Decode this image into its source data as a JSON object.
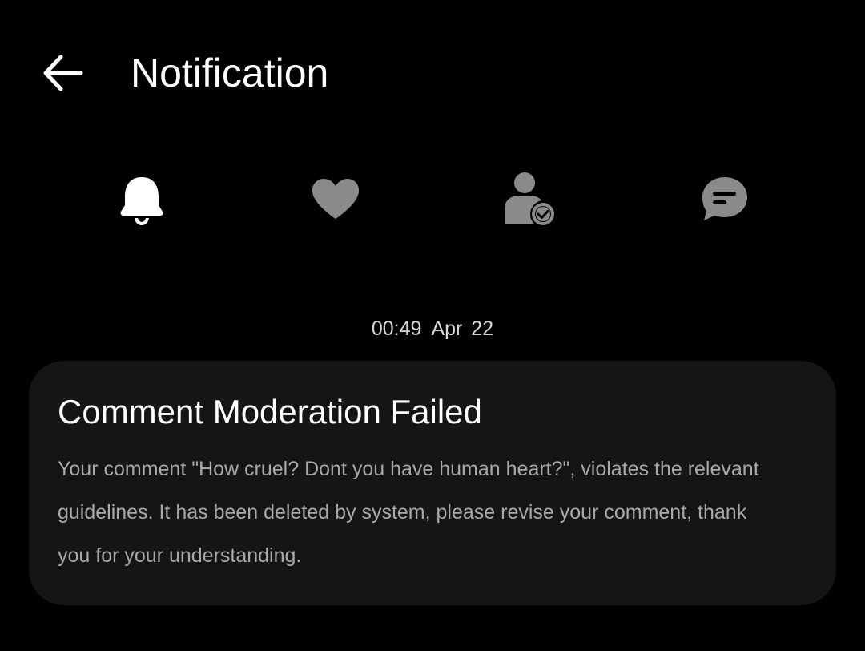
{
  "header": {
    "title": "Notification",
    "back_icon": "arrow-left-icon"
  },
  "tabs": [
    {
      "icon": "bell-icon",
      "active": true,
      "color": "#ffffff"
    },
    {
      "icon": "heart-icon",
      "active": false,
      "color": "#8a8a8a"
    },
    {
      "icon": "user-check-icon",
      "active": false,
      "color": "#8a8a8a"
    },
    {
      "icon": "chat-bubble-icon",
      "active": false,
      "color": "#8a8a8a"
    }
  ],
  "message": {
    "time": "00:49",
    "date": "Apr 22",
    "title": "Comment Moderation Failed",
    "body": "Your comment \"How cruel? Dont you have human heart?\", violates the relevant guidelines. It has been deleted by system, please revise your comment, thank you for your understanding."
  },
  "colors": {
    "background": "#000000",
    "card_background": "#151515",
    "body_text": "#a9a9a9",
    "inactive_icon": "#8a8a8a",
    "active_icon": "#ffffff"
  }
}
